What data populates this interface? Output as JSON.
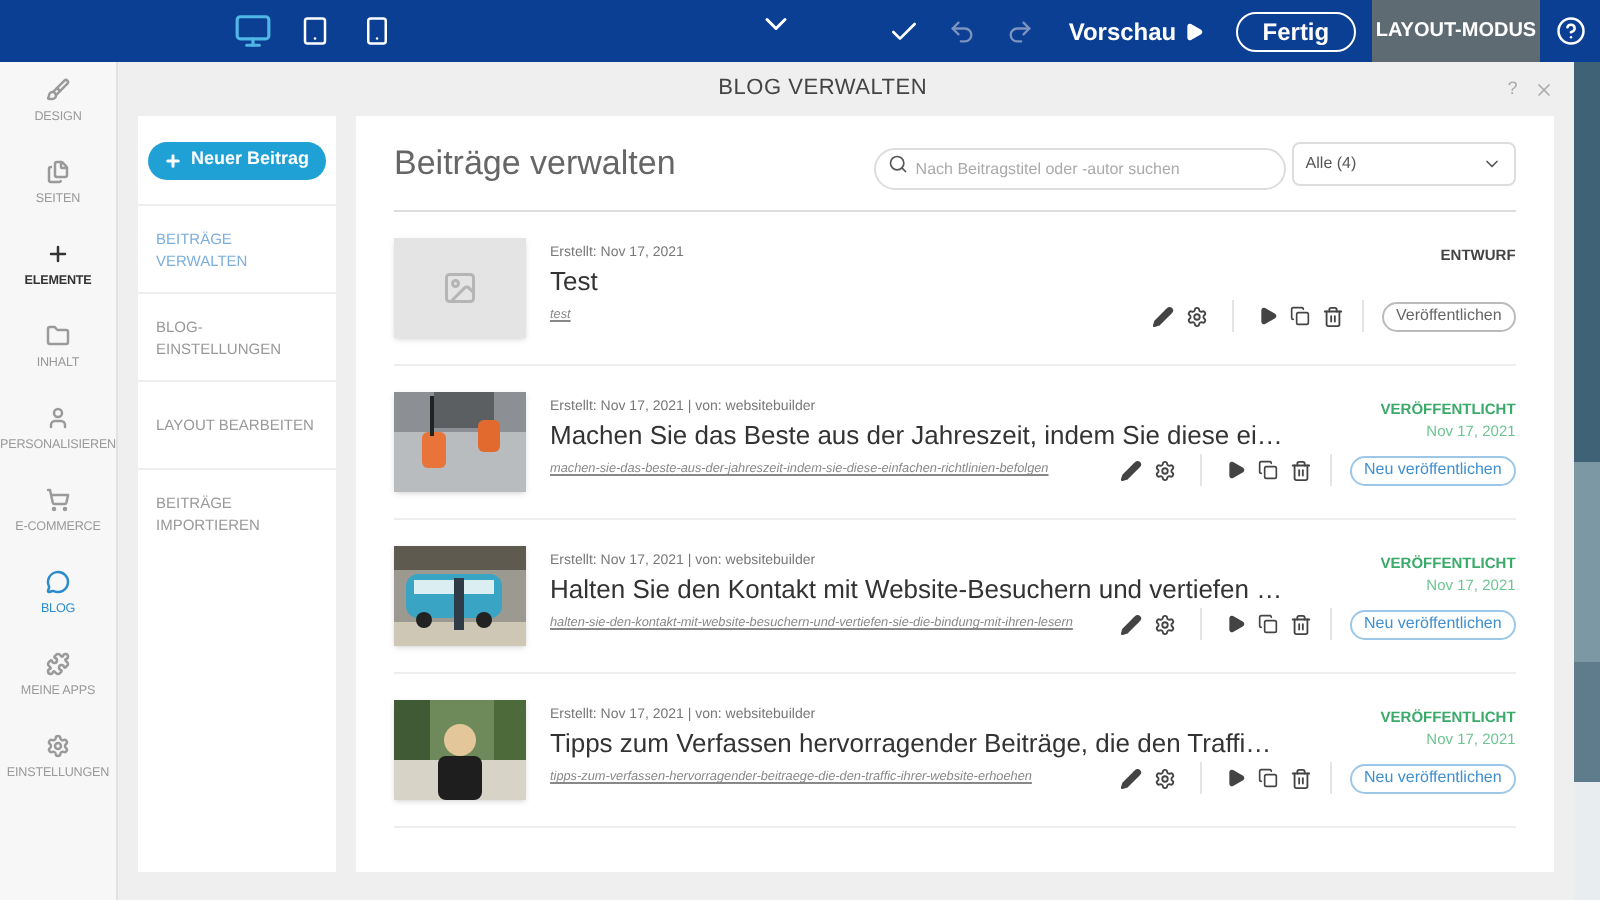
{
  "toolbar": {
    "devices": [
      {
        "kind": "desktop",
        "selected": true
      },
      {
        "kind": "tablet",
        "selected": false
      },
      {
        "kind": "phone",
        "selected": false
      }
    ],
    "preview": "Vorschau",
    "done": "Fertig",
    "mode": "LAYOUT-MODUS",
    "undo_disabled": true,
    "redo_disabled": true
  },
  "sidebar": {
    "items": [
      {
        "kind": "brush",
        "label": "DESIGN",
        "selected": false,
        "highlighted": false
      },
      {
        "kind": "pages",
        "label": "SEITEN",
        "selected": false,
        "highlighted": false
      },
      {
        "kind": "plus",
        "label": "ELEMENTE",
        "selected": false,
        "highlighted": true
      },
      {
        "kind": "folder",
        "label": "INHALT",
        "selected": false,
        "highlighted": false
      },
      {
        "kind": "person",
        "label": "PERSONALISIEREN",
        "selected": false,
        "highlighted": false
      },
      {
        "kind": "cart",
        "label": "E-COMMERCE",
        "selected": false,
        "highlighted": false
      },
      {
        "kind": "chat",
        "label": "BLOG",
        "selected": true,
        "highlighted": false
      },
      {
        "kind": "puzzle",
        "label": "MEINE APPS",
        "selected": false,
        "highlighted": false
      },
      {
        "kind": "gear",
        "label": "EINSTELLUNGEN",
        "selected": false,
        "highlighted": false
      }
    ]
  },
  "dialog": {
    "title": "BLOG VERWALTEN",
    "help": "?",
    "new_post": "Neuer Beitrag",
    "menu": [
      {
        "label": "BEITRÄGE VERWALTEN",
        "selected": true
      },
      {
        "label": "BLOG-EINSTELLUNGEN",
        "selected": false
      },
      {
        "label": "LAYOUT BEARBEITEN",
        "selected": false
      },
      {
        "label": "BEITRÄGE IMPORTIEREN",
        "selected": false
      }
    ],
    "heading": "Beiträge verwalten",
    "search": {
      "placeholder": "Nach Beitragstitel oder -autor suchen"
    },
    "filter": "Alle (4)",
    "posts": [
      {
        "kind": "draft",
        "meta": "Erstellt: Nov 17, 2021",
        "title": "Test",
        "slug": "test",
        "status": "ENTWURF",
        "action": "Veröffentlichen"
      },
      {
        "kind": "published",
        "meta": "Erstellt: Nov 17, 2021 | von: websitebuilder",
        "title": "Machen Sie das Beste aus der Jahreszeit, indem Sie diese ei…",
        "slug": "machen-sie-das-beste-aus-der-jahreszeit-indem-sie-diese-einfachen-richtlinien-befolgen",
        "status": "VERÖFFENTLICHT",
        "date": "Nov 17, 2021",
        "action": "Neu veröffentlichen"
      },
      {
        "kind": "published",
        "meta": "Erstellt: Nov 17, 2021 | von: websitebuilder",
        "title": "Halten Sie den Kontakt mit Website-Besuchern und vertiefen …",
        "slug": "halten-sie-den-kontakt-mit-website-besuchern-und-vertiefen-sie-die-bindung-mit-ihren-lesern",
        "status": "VERÖFFENTLICHT",
        "date": "Nov 17, 2021",
        "action": "Neu veröffentlichen"
      },
      {
        "kind": "published",
        "meta": "Erstellt: Nov 17, 2021 | von: websitebuilder",
        "title": "Tipps zum Verfassen hervorragender Beiträge, die den Traffi…",
        "slug": "tipps-zum-verfassen-hervorragender-beitraege-die-den-traffic-ihrer-website-erhoehen",
        "status": "VERÖFFENTLICHT",
        "date": "Nov 17, 2021",
        "action": "Neu veröffentlichen"
      }
    ]
  }
}
